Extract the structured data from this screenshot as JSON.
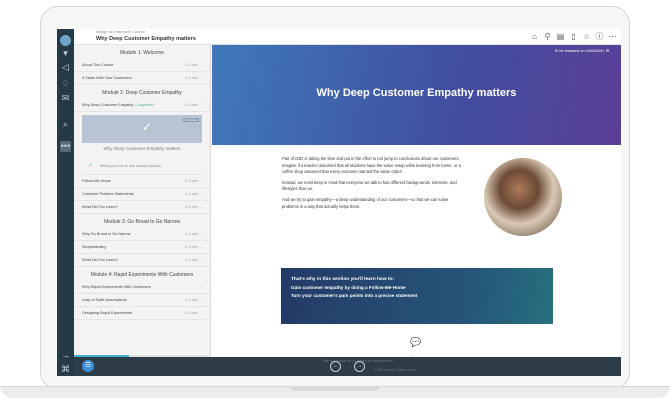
{
  "header": {
    "breadcrumb": "Bridge to Employee Course",
    "title": "Why Deep Customer Empathy matters"
  },
  "topicons": [
    "home-icon",
    "tools-icon",
    "notes-icon",
    "bookmark-icon",
    "star-icon",
    "help-icon",
    "more-icon"
  ],
  "sidebar": {
    "module1": "Module 1: Welcome",
    "m1": [
      {
        "label": "About This Course",
        "meta": "⊙ 2 min ⌄"
      },
      {
        "label": "It Starts With Your Customers",
        "meta": "⊙ 2 min ⌄"
      }
    ],
    "module2": "Module 2: Deep Customer Empathy",
    "m2current": {
      "label": "Why Deep Customer Empathy",
      "status": "Completed",
      "meta": "⊙ 3 min ⌃"
    },
    "card": {
      "badge": "1/1 done",
      "title": "Why Deep Customer Empathy matters"
    },
    "know": "What you'll do in this module (know)",
    "m2rest": [
      {
        "label": "Follow-Me-Home",
        "meta": "⊙ 3 min ⌄"
      },
      {
        "label": "Customer Problem Statements",
        "meta": "⊙ 2 min ⌄"
      },
      {
        "label": "What Did You Learn?",
        "meta": "⊙ 2 min ⌄"
      }
    ],
    "module3": "Module 3: Go Broad to Go Narrow",
    "m3": [
      {
        "label": "Why Go Broad to Go Narrow",
        "meta": "⊙ 2 min ⌄"
      },
      {
        "label": "Storyboarding",
        "meta": "⊙ 3 min ⌄"
      },
      {
        "label": "What Did You Learn?",
        "meta": "⊙ 2 min ⌄"
      }
    ],
    "module4": "Module 4: Rapid Experiments With Customers",
    "m4": [
      {
        "label": "Why Rapid Experiments With Customers",
        "meta": "⌄"
      },
      {
        "label": "Leap of Faith Assumptions",
        "meta": "⊙ 2 min ⌄"
      },
      {
        "label": "Designing Rapid Experiments",
        "meta": "⊙ 3 min ⌄"
      }
    ]
  },
  "main": {
    "release": "To be released on 16/03/2021",
    "hero_title": "Why Deep Customer Empathy matters",
    "paras": [
      "Part of D4D is taking the time and put in the effort to not jump to conclusions about our customers. Imagine if a teacher assumed that all students have the same setup while learning from home, or a coffee shop assumed that every customer wanted the same order!",
      "Instead, we must keep in mind that everyone we talk to has different backgrounds, interests, and lifestyles than us.",
      "And we try to gain empathy—a deep understanding of our customers—so that we can solve problems in a way that actually helps them."
    ],
    "callout": {
      "heading": "That's why in this section you'll learn how to:",
      "items": [
        "Gain customer empathy by doing a Follow-Me-Home",
        "Turn your customer's pain points into a precise statement"
      ]
    },
    "discuss": "Discuss"
  },
  "bottom": {
    "caption": "The downside of jumping to conclusions",
    "sub": "⊙ 299 points · Points Guide"
  }
}
